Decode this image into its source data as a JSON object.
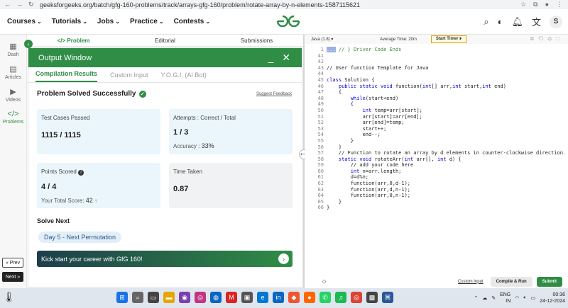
{
  "browser": {
    "url": "geeksforgeeks.org/batch/gfg-160-problems/track/arrays-gfg-160/problem/rotate-array-by-n-elements-1587115621"
  },
  "header": {
    "menu": [
      "Courses",
      "Tutorials",
      "Jobs",
      "Practice",
      "Contests"
    ],
    "logo": "GfG",
    "avatar": "S"
  },
  "rail": {
    "items": [
      "Dash",
      "Articles",
      "Videos",
      "Problems"
    ],
    "prev": "« Prev",
    "next": "Next »"
  },
  "problem_tabs": [
    "</> Problem",
    "Editorial",
    "Submissions"
  ],
  "output": {
    "title": "Output Window",
    "tabs": [
      "Compilation Results",
      "Custom Input",
      "Y.O.G.I. (AI Bot)"
    ],
    "status": "Problem Solved Successfully",
    "suggest": "Suggest Feedback",
    "test_cases_label": "Test Cases Passed",
    "test_cases_value": "1115 / 1115",
    "attempts_label": "Attempts : Correct / Total",
    "attempts_value": "1 / 3",
    "accuracy_label": "Accuracy :",
    "accuracy_value": "33%",
    "points_label": "Points Scored",
    "points_value": "4 / 4",
    "total_score_label": "Your Total Score:",
    "total_score_value": "42",
    "time_label": "Time Taken",
    "time_value": "0.87",
    "solve_next": "Solve Next",
    "next_problem": "Day 5 - Next Permutation",
    "kick": "Kick start your career with GfG 160!"
  },
  "editor": {
    "language": "Java (1.8)",
    "avg_time": "Average Time: 20m",
    "timer": "Start Timer",
    "line_numbers": [
      "1",
      "41",
      "42",
      "43",
      "44",
      "45",
      "46",
      "47",
      "48",
      "49",
      "50",
      "51",
      "52",
      "53",
      "54",
      "55",
      "56",
      "57",
      "58",
      "59",
      "60",
      "61",
      "62",
      "63",
      "64",
      "65",
      "66"
    ],
    "lines": [
      "} Driver Code Ends",
      "",
      "",
      "// User function Template for Java",
      "",
      "class Solution {",
      "    public static void function(int[] arr,int start,int end)",
      "    {",
      "        while(start<end)",
      "        {",
      "            int temp=arr[start];",
      "            arr[start]=arr[end];",
      "            arr[end]=temp;",
      "            start++;",
      "            end--;",
      "        }",
      "    }",
      "    // Function to rotate an array by d elements in counter-clockwise direction.",
      "    static void rotateArr(int arr[], int d) {",
      "        // add your code here",
      "        int n=arr.length;",
      "        d=d%n;",
      "        function(arr,0,d-1);",
      "        function(arr,d,n-1);",
      "        function(arr,0,n-1);",
      "    }",
      "}"
    ],
    "custom_input": "Custom Input",
    "compile": "Compile & Run",
    "submit": "Submit"
  },
  "taskbar": {
    "lang": "ENG",
    "region": "IN",
    "time": "00:36",
    "date": "24-12-2024"
  }
}
